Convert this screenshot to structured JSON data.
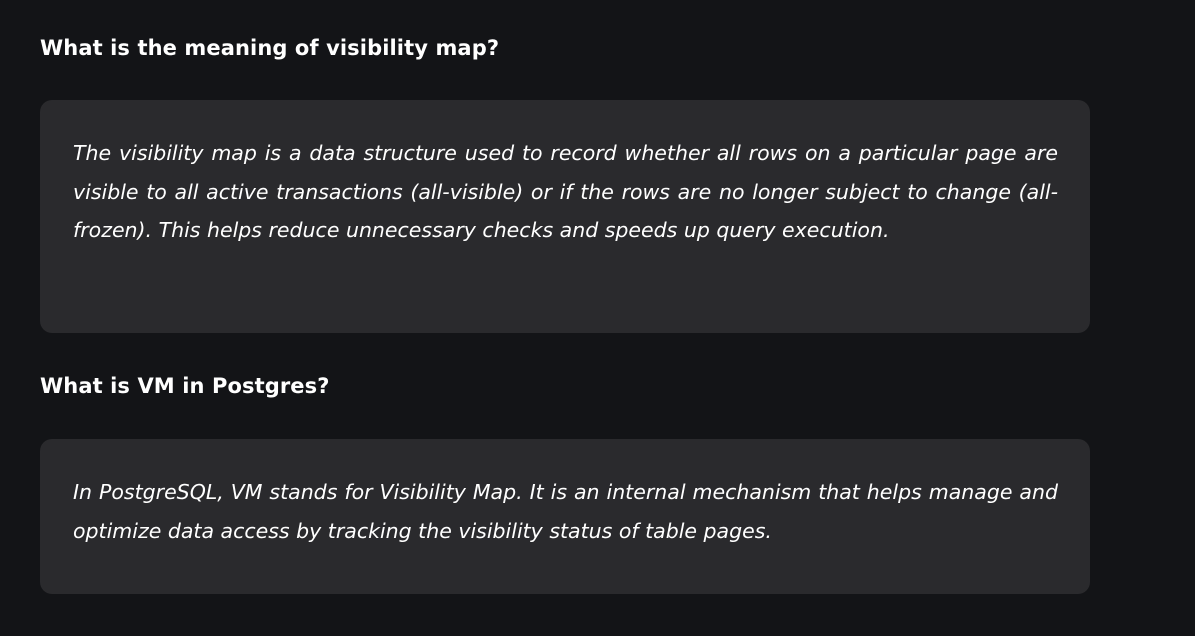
{
  "faq": [
    {
      "question": "What is the meaning of visibility map?",
      "answer": "The visibility map is a data structure used to record whether all rows on a particular page are visible to all active transactions (all-visible) or if the rows are no longer subject to change (all-frozen). This helps reduce unnecessary checks and speeds up query execution."
    },
    {
      "question": "What is VM in Postgres?",
      "answer": "In PostgreSQL, VM stands for Visibility Map. It is an internal mechanism that helps manage and optimize data access by tracking the visibility status of table pages."
    }
  ],
  "colors": {
    "background": "#131417",
    "card": "#2a2a2d",
    "text": "#ffffff"
  }
}
